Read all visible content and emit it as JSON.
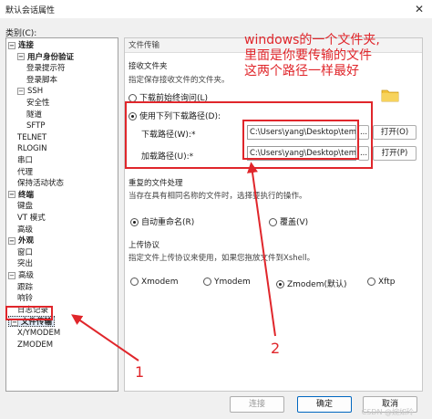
{
  "window": {
    "title": "默认会话属性",
    "close_glyph": "✕"
  },
  "category_label": "类别(C):",
  "tree": [
    {
      "label": "连接",
      "toggle": "−",
      "bold": true
    },
    {
      "label": "用户身份验证",
      "toggle": "−",
      "bold": true
    },
    {
      "label": "登录提示符"
    },
    {
      "label": "登录脚本"
    },
    {
      "label": "SSH",
      "toggle": "−"
    },
    {
      "label": "安全性"
    },
    {
      "label": "隧道"
    },
    {
      "label": "SFTP"
    },
    {
      "label": "TELNET"
    },
    {
      "label": "RLOGIN"
    },
    {
      "label": "串口"
    },
    {
      "label": "代理"
    },
    {
      "label": "保持活动状态"
    },
    {
      "label": "终端",
      "toggle": "−",
      "bold": true
    },
    {
      "label": "键盘"
    },
    {
      "label": "VT 模式"
    },
    {
      "label": "高级"
    },
    {
      "label": "外观",
      "toggle": "−",
      "bold": true
    },
    {
      "label": "窗口"
    },
    {
      "label": "突出"
    },
    {
      "label": "高级",
      "toggle": "−"
    },
    {
      "label": "跟踪"
    },
    {
      "label": "响铃"
    },
    {
      "label": "日志记录"
    },
    {
      "label": "文件传输",
      "toggle": "−",
      "bold": true,
      "selected": true
    },
    {
      "label": "X/YMODEM"
    },
    {
      "label": "ZMODEM"
    }
  ],
  "panel": {
    "title": "文件传输",
    "receive": {
      "section": "接收文件夹",
      "desc": "指定保存接收文件的文件夹。",
      "option_ask": "下载前始终询问(L)",
      "option_use": "使用下列下载路径(D):",
      "download_label": "下载路径(W):*",
      "download_value": "C:\\Users\\yang\\Desktop\\temp",
      "upload_label": "加载路径(U):*",
      "upload_value": "C:\\Users\\yang\\Desktop\\temp",
      "browse": "...",
      "open_o": "打开(O)",
      "open_p": "打开(P)"
    },
    "duplicate": {
      "section": "重复的文件处理",
      "desc": "当存在具有相同名称的文件时，选择要执行的操作。",
      "auto_rename": "自动重命名(R)",
      "overwrite": "覆盖(V)"
    },
    "upload": {
      "section": "上传协议",
      "desc": "指定文件上传协议来使用，如果您拖放文件到Xshell。",
      "xmodem": "Xmodem",
      "ymodem": "Ymodem",
      "zmodem": "Zmodem(默认)",
      "xftp": "Xftp"
    }
  },
  "buttons": {
    "connect": "连接",
    "ok": "确定",
    "cancel": "取消"
  },
  "annotation": {
    "note_line1": "windows的一个文件夹,",
    "note_line2": "里面是你要传输的文件",
    "note_line3": "这两个路径一样最好",
    "marker1": "1",
    "marker2": "2",
    "color": "#e0262b"
  },
  "watermark": "CSDN @婉如玲"
}
